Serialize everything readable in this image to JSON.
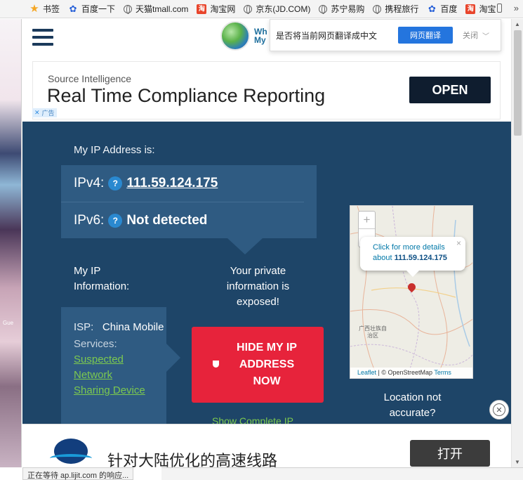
{
  "bookmarks": {
    "items": [
      {
        "label": "书签",
        "icon": "star-icon"
      },
      {
        "label": "百度一下",
        "icon": "baidu-icon"
      },
      {
        "label": "天猫tmall.com",
        "icon": "globe-icon"
      },
      {
        "label": "淘宝网",
        "icon": "taobao-icon"
      },
      {
        "label": "京东(JD.COM)",
        "icon": "globe-icon"
      },
      {
        "label": "苏宁易购",
        "icon": "globe-icon"
      },
      {
        "label": "携程旅行",
        "icon": "globe-icon"
      },
      {
        "label": "百度",
        "icon": "baidu-icon"
      },
      {
        "label": "淘宝",
        "icon": "taobao-icon"
      }
    ],
    "more": "»"
  },
  "header": {
    "logo_text_1": "Wh",
    "logo_text_2": "My"
  },
  "translate_bar": {
    "message": "是否将当前网页翻译成中文",
    "button": "网页翻译",
    "close": "关闭"
  },
  "ad_top": {
    "subtitle": "Source Intelligence",
    "headline": "Real Time Compliance Reporting",
    "cta": "OPEN",
    "adchoice": "广告"
  },
  "ip_panel": {
    "title": "My IP Address is:",
    "ipv4_label": "IPv4:",
    "ipv4_value": "111.59.124.175",
    "ipv6_label": "IPv6:",
    "ipv6_value": "Not detected",
    "help_mark": "?",
    "info_label": "My IP Information:",
    "private_text": "Your private information is exposed!",
    "isp_key": "ISP:",
    "isp_value": "China Mobile",
    "services_key": "Services:",
    "services_links": [
      "Suspected",
      "Network",
      "Sharing Device"
    ],
    "hide_button": "HIDE MY IP ADDRESS NOW",
    "show_complete": "Show Complete IP",
    "location_text": "Location not accurate?"
  },
  "map": {
    "zoom_in": "+",
    "zoom_out": "−",
    "popup_line1": "Click for more details",
    "popup_line2_prefix": "about",
    "popup_ip": "111.59.124.175",
    "popup_close": "×",
    "region_label": "广西壮族自治区",
    "attrib_leaflet": "Leaflet",
    "attrib_mid": "| © OpenStreetMap",
    "attrib_terms": "Terms"
  },
  "ad_bottom": {
    "text": "针对大陆优化的高速线路",
    "cta": "打开"
  },
  "status_bar": {
    "text": "正在等待 ap.lijit.com 的响应..."
  },
  "left_strip": {
    "hint": "Gue"
  }
}
